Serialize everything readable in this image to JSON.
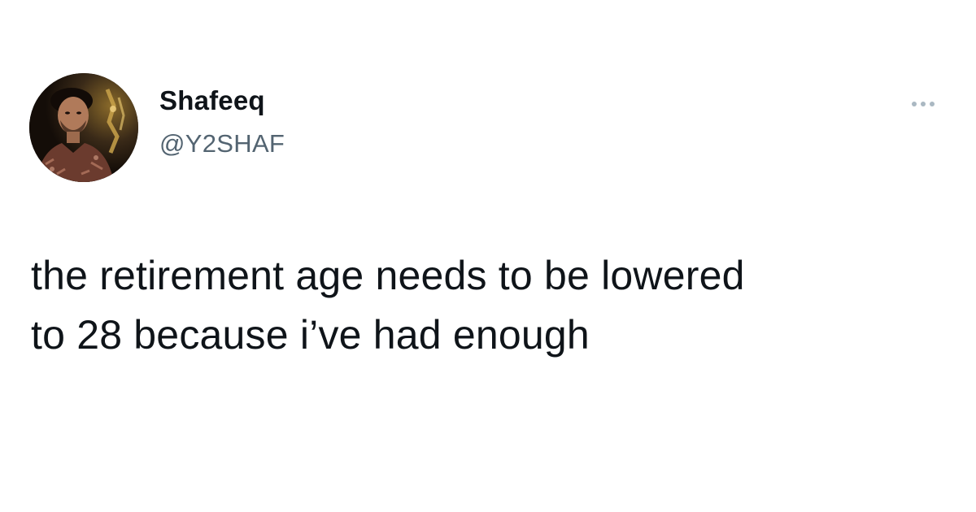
{
  "author": {
    "display_name": "Shafeeq",
    "handle": "@Y2SHAF"
  },
  "avatar": {
    "icon": "profile-photo"
  },
  "menu": {
    "icon": "more-horizontal-icon"
  },
  "tweet": {
    "lines": [
      "the retirement age needs to be lowered",
      "to 28 because i’ve had enough"
    ]
  },
  "colors": {
    "text_primary": "#0f1419",
    "text_secondary": "#536471",
    "more_dots": "#aab8c2",
    "background": "#ffffff"
  }
}
